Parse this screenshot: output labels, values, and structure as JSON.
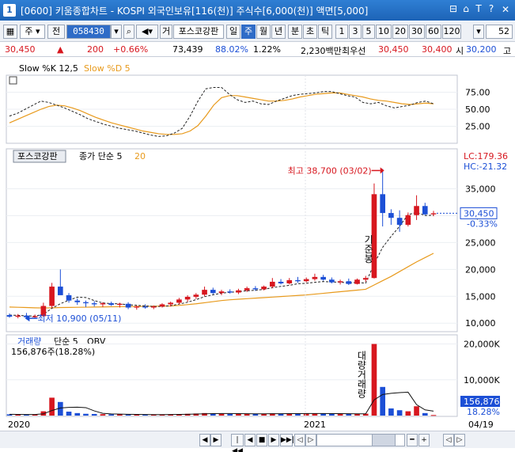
{
  "window": {
    "number": "1",
    "title": "[0600] 키움종합차트 - KOSPI 외국인보유[116(천)] 주식수[6,000(천)] 액면[5,000]",
    "controls": [
      "⊟",
      "⌂",
      "T",
      "?"
    ],
    "close": "✕"
  },
  "toolbar": {
    "market": "주",
    "prev": "전",
    "stock_code": "058430",
    "sound": "◀",
    "stock_name_prefix": "거",
    "stock_name": "포스코강판",
    "periods": [
      "일",
      "주",
      "월",
      "년",
      "분",
      "초",
      "틱"
    ],
    "selected_period": "주",
    "intervals": [
      "1",
      "3",
      "5",
      "10",
      "20",
      "30",
      "60",
      "120"
    ],
    "count": "52"
  },
  "pricebar": {
    "price": "30,450",
    "change_arrow": "▲",
    "change": "200",
    "change_pct": "+0.66%",
    "volume": "73,439",
    "volume_ratio": "88.02%",
    "turnover": "1.22%",
    "amount": "2,230백만",
    "best_label": "최우선",
    "ask": "30,450",
    "bid": "30,400",
    "open_label": "시",
    "open": "30,200",
    "high_label": "고"
  },
  "stoch_panel": {
    "title_k": "Slow %K 12,5",
    "title_d": "Slow %D 5",
    "y_ticks": [
      "75.00",
      "50.00",
      "25.00"
    ]
  },
  "price_panel": {
    "name_tag": "포스코강판",
    "ma_label": "종가 단순 5",
    "ma_value": "20",
    "high_annotation": "최고 38,700 (03/02)",
    "low_annotation": "최저 10,900 (05/11)",
    "vertical_text": "기준봉",
    "lc": "LC:179.36",
    "hc": "HC:-21.32",
    "current_price": "30,450",
    "current_pct": "-0.33%",
    "y_ticks": [
      "35,000",
      "30,000",
      "25,000",
      "20,000",
      "15,000",
      "10,000"
    ]
  },
  "volume_panel": {
    "title": "거래량",
    "ma_label": "단순 5",
    "obv_label": "OBV",
    "info": "156,876주(18.28%)",
    "vertical_text": "대량거래량",
    "current_volume": "156,876",
    "current_pct": "18.28%",
    "y_ticks": [
      "20,000K",
      "10,000K"
    ]
  },
  "x_axis": {
    "labels": [
      "2020",
      "2021",
      "04/19"
    ]
  },
  "scrollbar": {
    "buttons": [
      "◀",
      "▶",
      "|◀◀",
      "◀",
      "■",
      "▶",
      "▶▶|",
      "◁",
      "▷",
      "━",
      "+",
      "◁",
      "▷"
    ]
  },
  "colors": {
    "up": "#d7171f",
    "down": "#1c4fd6",
    "ma20": "#e89a1c",
    "titlebar": "#1d63b6"
  },
  "chart_data": [
    {
      "type": "candlestick",
      "title": "",
      "unit": "KRW",
      "ylim": [
        9000,
        39500
      ],
      "x_start_label": "2020",
      "candles": [
        {
          "o": 11500,
          "h": 11800,
          "l": 11000,
          "c": 11200
        },
        {
          "o": 11200,
          "h": 11700,
          "l": 10900,
          "c": 11400
        },
        {
          "o": 11400,
          "h": 11900,
          "l": 11000,
          "c": 11100
        },
        {
          "o": 11100,
          "h": 11600,
          "l": 10950,
          "c": 11300
        },
        {
          "o": 11300,
          "h": 13800,
          "l": 11200,
          "c": 13200
        },
        {
          "o": 13200,
          "h": 17500,
          "l": 12800,
          "c": 16800
        },
        {
          "o": 16800,
          "h": 20000,
          "l": 15500,
          "c": 15200
        },
        {
          "o": 15200,
          "h": 15600,
          "l": 13800,
          "c": 14200
        },
        {
          "o": 14200,
          "h": 14600,
          "l": 13400,
          "c": 13900
        },
        {
          "o": 13900,
          "h": 14200,
          "l": 13000,
          "c": 13700
        },
        {
          "o": 13700,
          "h": 14100,
          "l": 13100,
          "c": 13500
        },
        {
          "o": 13500,
          "h": 13900,
          "l": 13000,
          "c": 13700
        },
        {
          "o": 13700,
          "h": 14000,
          "l": 13200,
          "c": 13400
        },
        {
          "o": 13400,
          "h": 13800,
          "l": 12900,
          "c": 13600
        },
        {
          "o": 13600,
          "h": 13900,
          "l": 12600,
          "c": 12900
        },
        {
          "o": 12900,
          "h": 13300,
          "l": 12500,
          "c": 13100
        },
        {
          "o": 13100,
          "h": 13500,
          "l": 12700,
          "c": 12900
        },
        {
          "o": 12900,
          "h": 13300,
          "l": 12600,
          "c": 13100
        },
        {
          "o": 13100,
          "h": 13700,
          "l": 12900,
          "c": 13500
        },
        {
          "o": 13500,
          "h": 14000,
          "l": 13100,
          "c": 13800
        },
        {
          "o": 13800,
          "h": 14700,
          "l": 13500,
          "c": 14400
        },
        {
          "o": 14400,
          "h": 15200,
          "l": 14000,
          "c": 14900
        },
        {
          "o": 14900,
          "h": 15600,
          "l": 14500,
          "c": 15300
        },
        {
          "o": 15300,
          "h": 16800,
          "l": 15000,
          "c": 16200
        },
        {
          "o": 16200,
          "h": 16600,
          "l": 15400,
          "c": 15600
        },
        {
          "o": 15600,
          "h": 16200,
          "l": 15200,
          "c": 15900
        },
        {
          "o": 15900,
          "h": 16300,
          "l": 15500,
          "c": 15700
        },
        {
          "o": 15700,
          "h": 16400,
          "l": 15400,
          "c": 16100
        },
        {
          "o": 16100,
          "h": 16800,
          "l": 15800,
          "c": 16500
        },
        {
          "o": 16500,
          "h": 16900,
          "l": 16000,
          "c": 16300
        },
        {
          "o": 16300,
          "h": 17000,
          "l": 16100,
          "c": 16800
        },
        {
          "o": 16800,
          "h": 18400,
          "l": 16500,
          "c": 17700
        },
        {
          "o": 17700,
          "h": 18200,
          "l": 17200,
          "c": 17400
        },
        {
          "o": 17400,
          "h": 18400,
          "l": 17200,
          "c": 18000
        },
        {
          "o": 18000,
          "h": 18600,
          "l": 17500,
          "c": 17800
        },
        {
          "o": 17800,
          "h": 18500,
          "l": 17600,
          "c": 18200
        },
        {
          "o": 18200,
          "h": 19200,
          "l": 17900,
          "c": 18600
        },
        {
          "o": 18600,
          "h": 19000,
          "l": 17900,
          "c": 18100
        },
        {
          "o": 18100,
          "h": 18500,
          "l": 17400,
          "c": 17600
        },
        {
          "o": 17600,
          "h": 18100,
          "l": 17200,
          "c": 17800
        },
        {
          "o": 17800,
          "h": 18300,
          "l": 17100,
          "c": 17300
        },
        {
          "o": 17300,
          "h": 18300,
          "l": 17200,
          "c": 18100
        },
        {
          "o": 18100,
          "h": 18800,
          "l": 17700,
          "c": 18400
        },
        {
          "o": 18400,
          "h": 36000,
          "l": 18300,
          "c": 34000
        },
        {
          "o": 34000,
          "h": 38700,
          "l": 28000,
          "c": 30500
        },
        {
          "o": 30500,
          "h": 31200,
          "l": 28300,
          "c": 29600
        },
        {
          "o": 29600,
          "h": 31000,
          "l": 27000,
          "c": 28300
        },
        {
          "o": 28300,
          "h": 30600,
          "l": 28000,
          "c": 30100
        },
        {
          "o": 30100,
          "h": 33800,
          "l": 29200,
          "c": 31800
        },
        {
          "o": 31800,
          "h": 32400,
          "l": 30100,
          "c": 30250
        },
        {
          "o": 30250,
          "h": 30900,
          "l": 29900,
          "c": 30450
        }
      ],
      "ma5": [
        11500,
        11450,
        11350,
        11300,
        11640,
        12760,
        13620,
        14260,
        14840,
        14760,
        14200,
        13760,
        13640,
        13580,
        13420,
        13320,
        13200,
        13100,
        13100,
        13260,
        13540,
        13900,
        14380,
        14920,
        15280,
        15580,
        15740,
        15860,
        16020,
        16120,
        16280,
        16600,
        16840,
        17040,
        17340,
        17420,
        17600,
        17740,
        17660,
        17620,
        17480,
        17580,
        17440,
        21040,
        24100,
        26160,
        28040,
        30200,
        30600,
        30040,
        30080
      ],
      "ma20": [
        13000,
        12950,
        12900,
        12850,
        12820,
        12850,
        12900,
        12920,
        12950,
        12970,
        13000,
        13020,
        13040,
        13060,
        13080,
        13100,
        13120,
        13150,
        13170,
        13200,
        13300,
        13450,
        13600,
        13800,
        14000,
        14200,
        14350,
        14450,
        14550,
        14650,
        14750,
        14850,
        14950,
        15050,
        15150,
        15250,
        15400,
        15550,
        15700,
        15850,
        16000,
        16150,
        16300,
        17100,
        17900,
        18700,
        19600,
        20500,
        21400,
        22200,
        23000
      ]
    },
    {
      "type": "bar",
      "title": "",
      "unit": "shares",
      "ylim": [
        0,
        21000000
      ],
      "values": [
        350000,
        300000,
        250000,
        330000,
        1200000,
        5000000,
        3800000,
        1100000,
        700000,
        500000,
        450000,
        400000,
        350000,
        330000,
        300000,
        280000,
        270000,
        260000,
        300000,
        350000,
        420000,
        500000,
        580000,
        700000,
        560000,
        520000,
        480000,
        500000,
        520000,
        470000,
        480000,
        620000,
        550000,
        600000,
        520000,
        560000,
        640000,
        580000,
        520000,
        480000,
        460000,
        500000,
        530000,
        20000000,
        8000000,
        2000000,
        1500000,
        1200000,
        2600000,
        700000,
        156876
      ]
    },
    {
      "type": "line",
      "title": "",
      "ylim": [
        0,
        100
      ],
      "slow_k": [
        40,
        44,
        50,
        56,
        62,
        60,
        56,
        52,
        47,
        42,
        36,
        32,
        28,
        25,
        22,
        20,
        18,
        15,
        12,
        10,
        11,
        15,
        22,
        40,
        62,
        80,
        82,
        82,
        72,
        64,
        60,
        62,
        58,
        57,
        62,
        66,
        70,
        72,
        73,
        74,
        76,
        76,
        73,
        70,
        68,
        60,
        58,
        60,
        55,
        52,
        54,
        56,
        60,
        62,
        58
      ],
      "slow_d": [
        30,
        35,
        40,
        45,
        50,
        54,
        56,
        55,
        52,
        48,
        43,
        38,
        34,
        30,
        27,
        24,
        21,
        18,
        16,
        14,
        13,
        13,
        14,
        18,
        26,
        40,
        56,
        67,
        70,
        70,
        68,
        66,
        64,
        62,
        62,
        63,
        65,
        68,
        70,
        72,
        73,
        74,
        74,
        72,
        70,
        68,
        65,
        63,
        62,
        60,
        58,
        57,
        58,
        59,
        58
      ]
    }
  ]
}
